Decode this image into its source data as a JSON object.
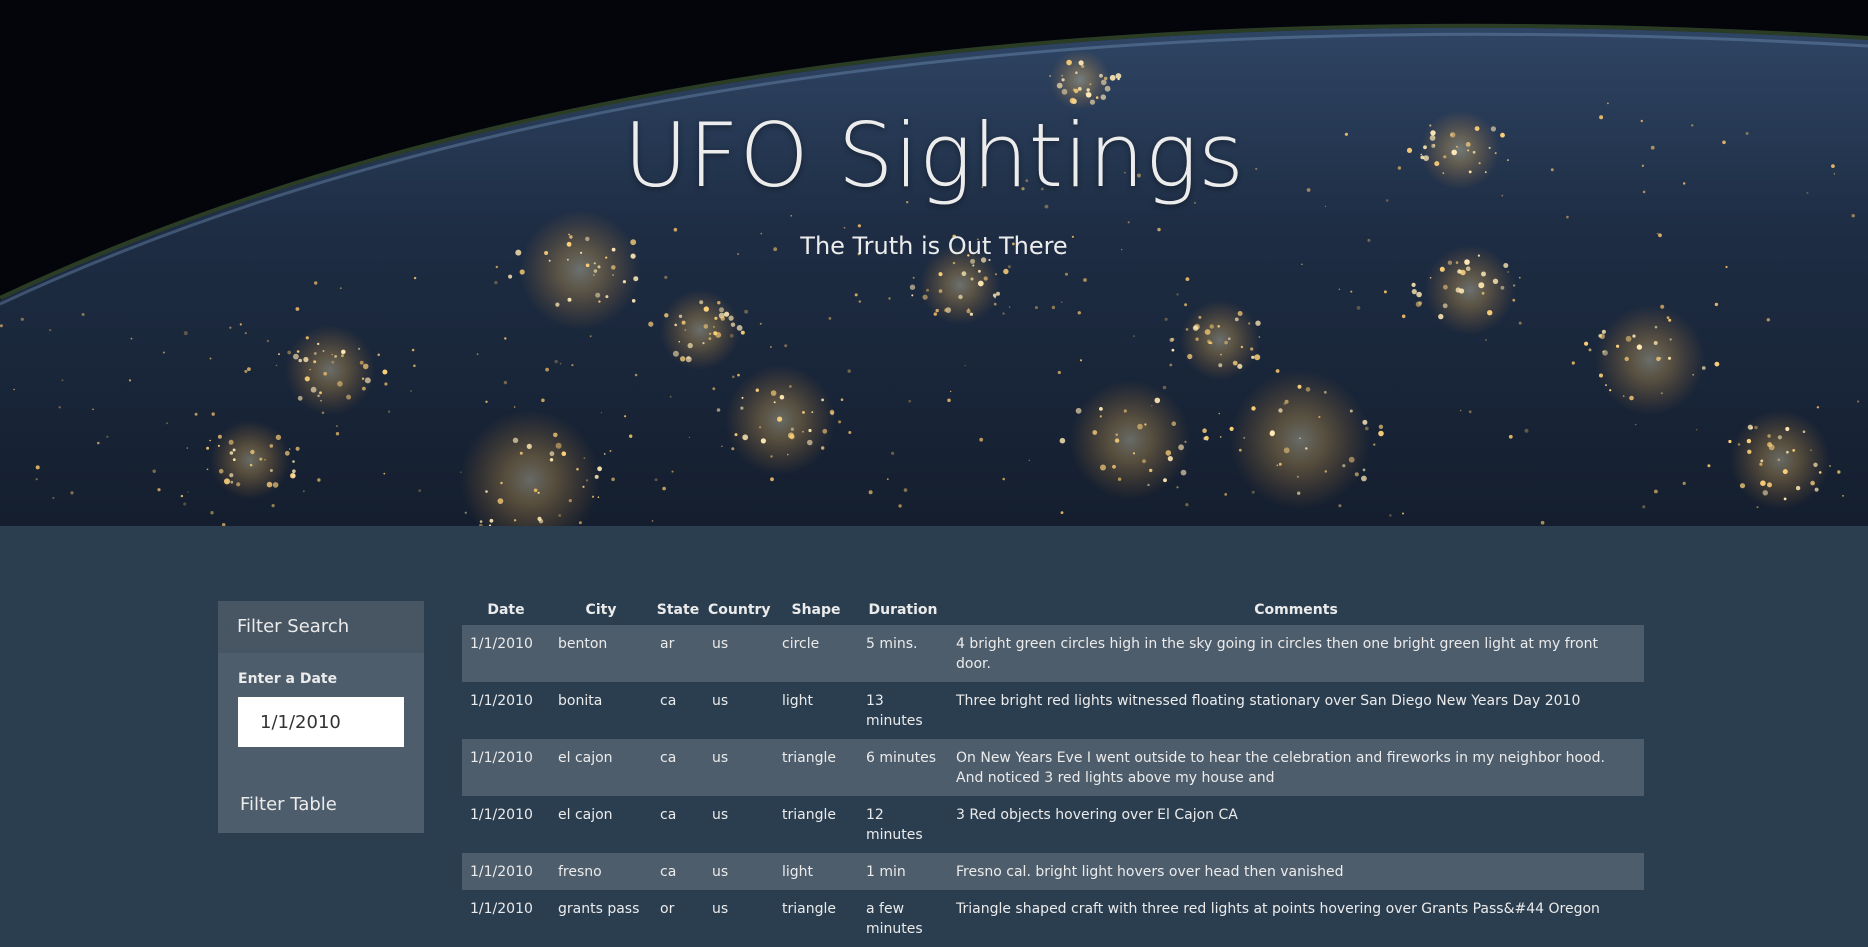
{
  "header": {
    "title": "UFO Sightings",
    "subtitle": "The Truth is Out There"
  },
  "sidebar": {
    "heading": "Filter Search",
    "date_label": "Enter a Date",
    "date_value": "1/1/2010",
    "button_label": "Filter Table"
  },
  "table": {
    "headers": [
      "Date",
      "City",
      "State",
      "Country",
      "Shape",
      "Duration",
      "Comments"
    ],
    "rows": [
      [
        "1/1/2010",
        "benton",
        "ar",
        "us",
        "circle",
        "5 mins.",
        "4 bright green circles high in the sky going in circles then one bright green light at my front door."
      ],
      [
        "1/1/2010",
        "bonita",
        "ca",
        "us",
        "light",
        "13 minutes",
        "Three bright red lights witnessed floating stationary over San Diego New Years Day 2010"
      ],
      [
        "1/1/2010",
        "el cajon",
        "ca",
        "us",
        "triangle",
        "6 minutes",
        "On New Years Eve I went outside to hear the celebration and fireworks in my neighbor hood. And noticed 3 red lights above my house and"
      ],
      [
        "1/1/2010",
        "el cajon",
        "ca",
        "us",
        "triangle",
        "12 minutes",
        "3 Red objects hovering over El Cajon CA"
      ],
      [
        "1/1/2010",
        "fresno",
        "ca",
        "us",
        "light",
        "1 min",
        "Fresno cal. bright light hovers over head then vanished"
      ],
      [
        "1/1/2010",
        "grants pass",
        "or",
        "us",
        "triangle",
        "a few minutes",
        "Triangle shaped craft with three red lights at points hovering over Grants Pass&#44 Oregon"
      ]
    ]
  },
  "colors": {
    "background": "#2b3e50",
    "panel": "#4e5d6c",
    "panel_header": "#485563",
    "text": "#ebebeb"
  }
}
